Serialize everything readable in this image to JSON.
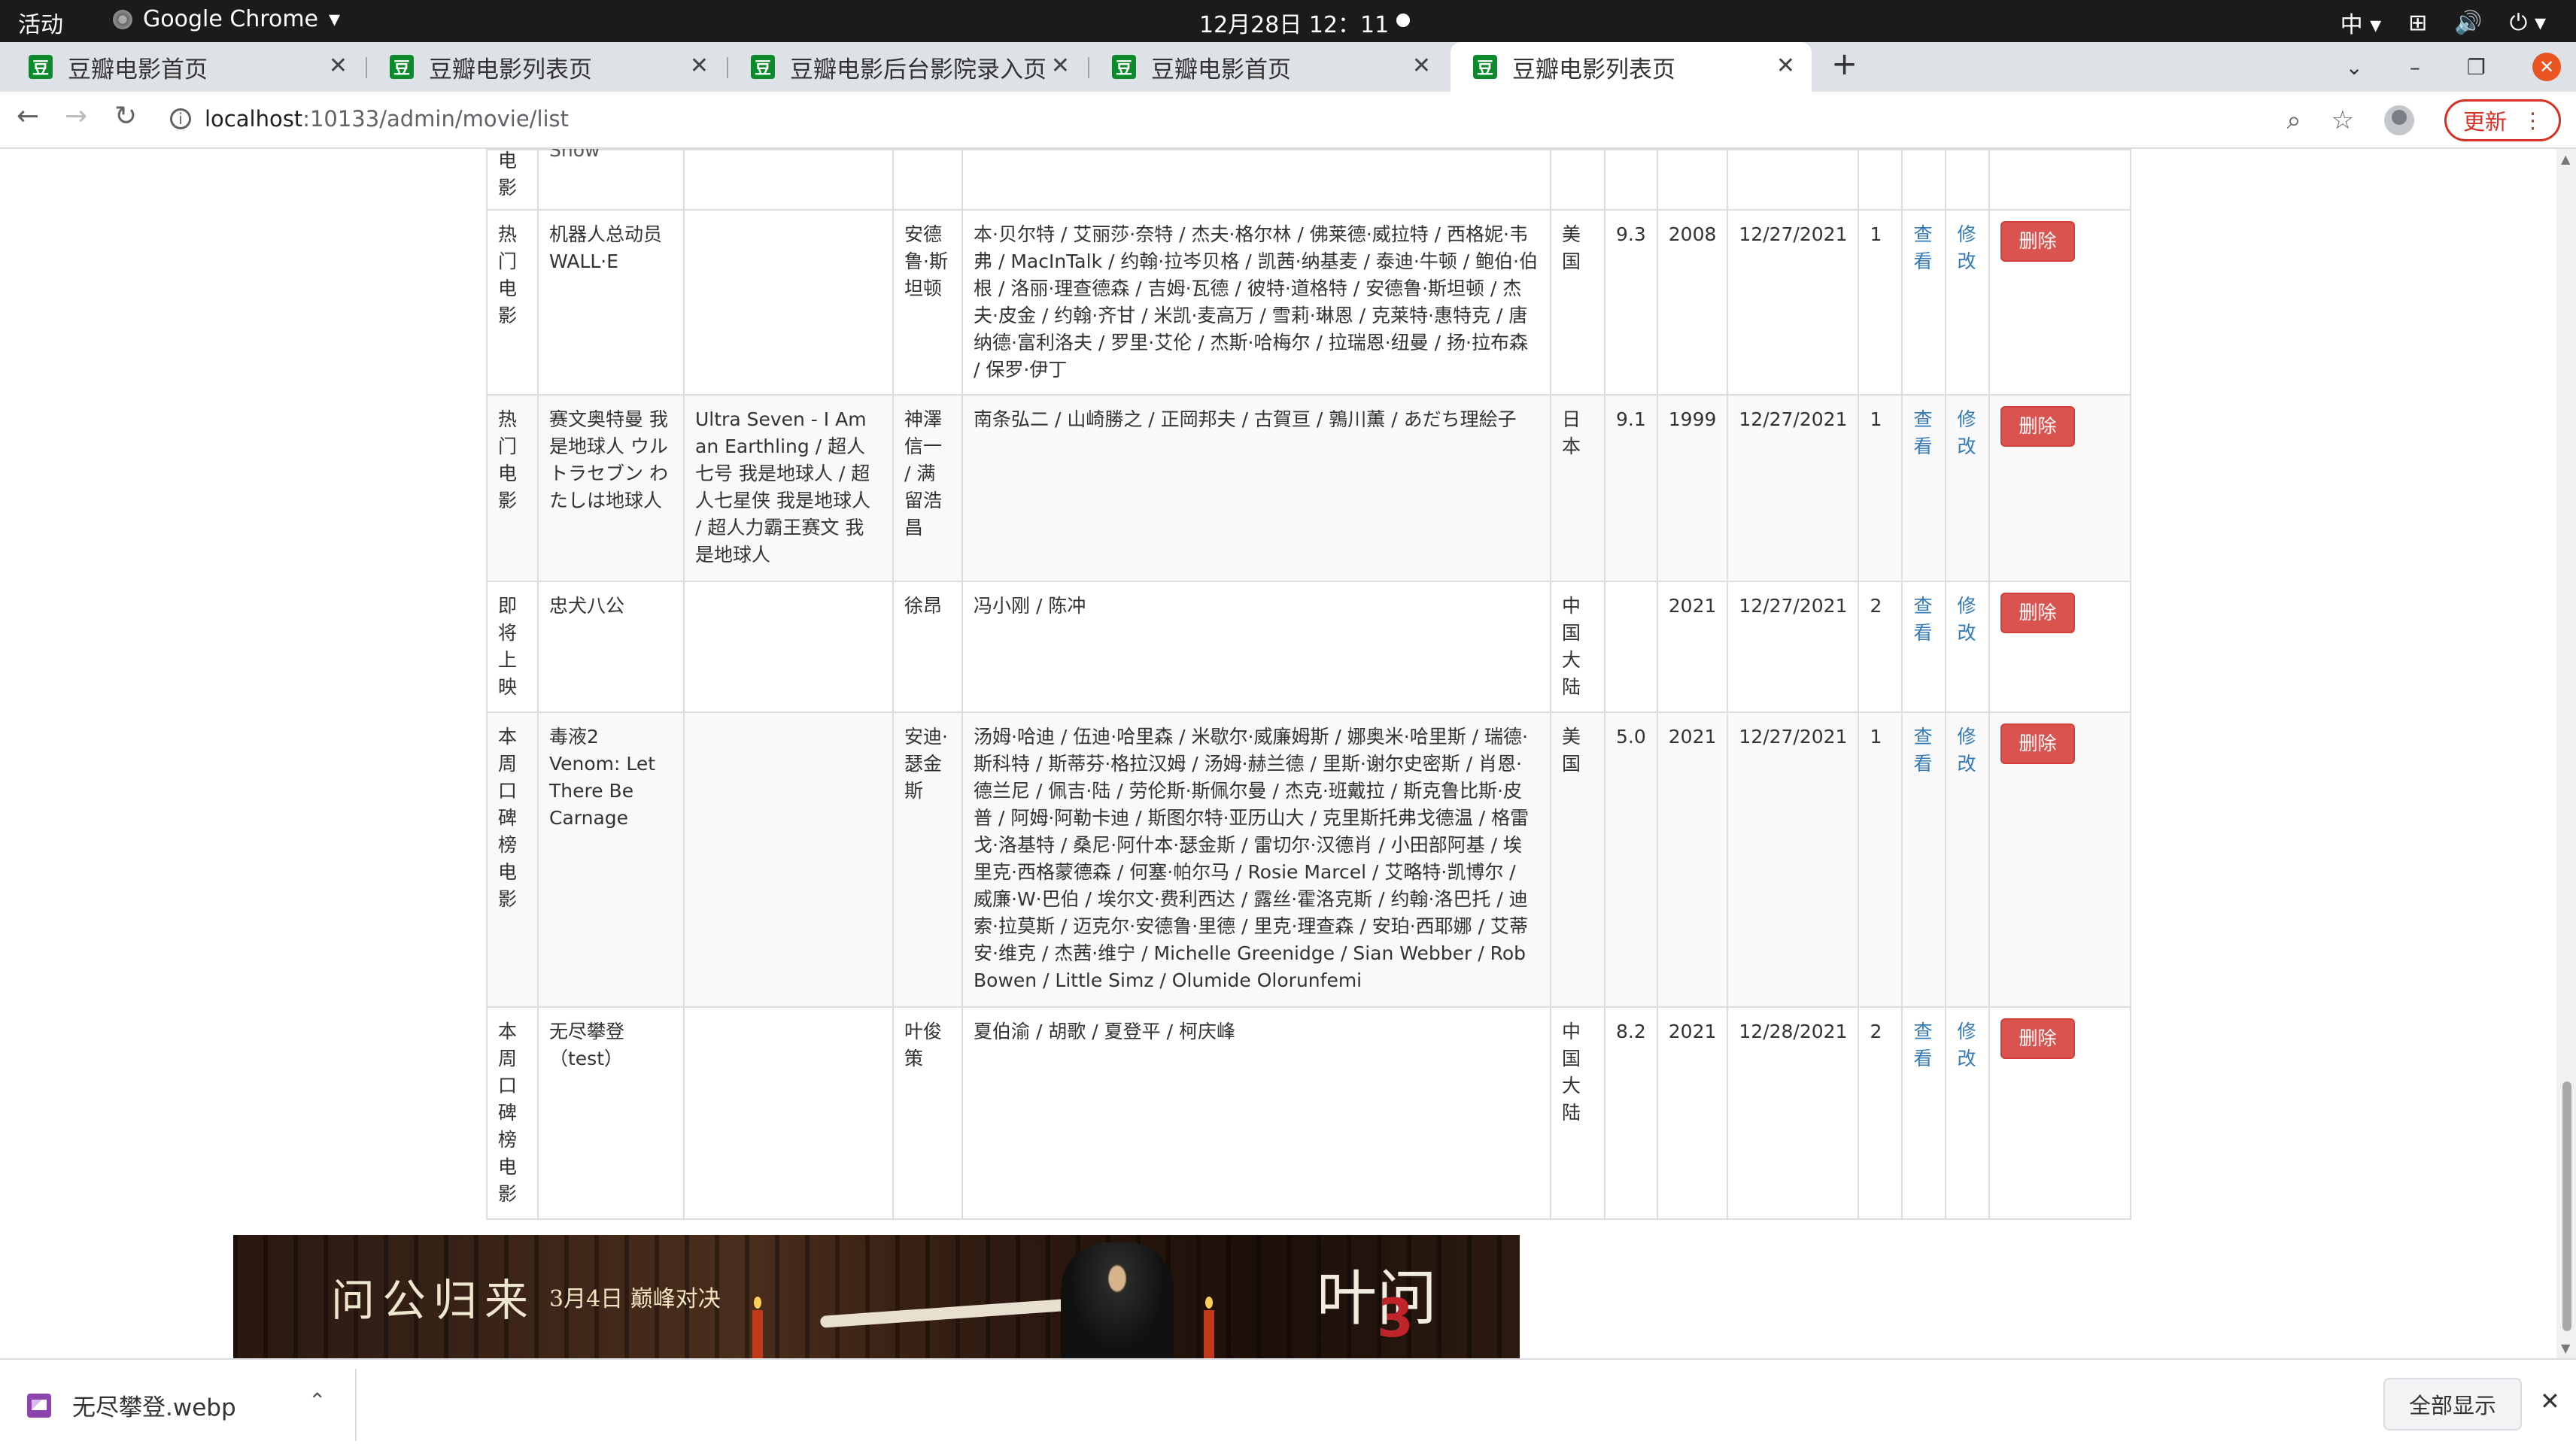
{
  "system": {
    "activities": "活动",
    "app_name": "Google Chrome",
    "clock": "12月28日  12：11",
    "input_method": "中"
  },
  "tabs": [
    {
      "title": "豆瓣电影首页",
      "favicon": "豆"
    },
    {
      "title": "豆瓣电影列表页",
      "favicon": "豆"
    },
    {
      "title": "豆瓣电影后台影院录入页",
      "favicon": "豆"
    },
    {
      "title": "豆瓣电影首页",
      "favicon": "豆"
    },
    {
      "title": "豆瓣电影列表页",
      "favicon": "豆",
      "active": true
    }
  ],
  "toolbar": {
    "url_host": "localhost",
    "url_path": ":10133/admin/movie/list",
    "update_label": "更新"
  },
  "table": {
    "partial_top_row": {
      "type": "电影",
      "name": "Show"
    },
    "rows": [
      {
        "type": "热门电影",
        "name": "机器人总动员 WALL·E",
        "alias": "",
        "director": "安德鲁·斯坦顿",
        "actors": "本·贝尔特 / 艾丽莎·奈特 / 杰夫·格尔林 / 佛莱德·威拉特 / 西格妮·韦弗 / MacInTalk / 约翰·拉岑贝格 / 凯茜·纳基麦 / 泰迪·牛顿 / 鲍伯·伯根 / 洛丽·理查德森 / 吉姆·瓦德 / 彼特·道格特 / 安德鲁·斯坦顿 / 杰夫·皮金 / 约翰·齐甘 / 米凯·麦高万 / 雪莉·琳恩 / 克莱特·惠特克 / 唐纳德·富利洛夫 / 罗里·艾伦 / 杰斯·哈梅尔 / 拉瑞恩·纽曼 / 扬·拉布森 / 保罗·伊丁",
        "region": "美国",
        "rating": "9.3",
        "year": "2008",
        "date": "12/27/2021",
        "count": "1"
      },
      {
        "type": "热门电影",
        "name": "赛文奥特曼 我是地球人 ウルトラセブン わたしは地球人",
        "alias": "Ultra Seven - I Am an Earthling / 超人七号 我是地球人 / 超人七星侠 我是地球人 / 超人力霸王赛文 我是地球人",
        "director": "神澤信一 / 满留浩昌",
        "actors": "南条弘二 / 山崎勝之 / 正岡邦夫 / 古賀亘 / 鶉川薫 / あだち理絵子",
        "region": "日本",
        "rating": "9.1",
        "year": "1999",
        "date": "12/27/2021",
        "count": "1"
      },
      {
        "type": "即将上映",
        "name": "忠犬八公",
        "alias": "",
        "director": "徐昂",
        "actors": "冯小刚 / 陈冲",
        "region": "中国大陆",
        "rating": "",
        "year": "2021",
        "date": "12/27/2021",
        "count": "2"
      },
      {
        "type": "本周口碑榜电影",
        "name": "毒液2 Venom: Let There Be Carnage",
        "alias": "",
        "director": "安迪·瑟金斯",
        "actors": "汤姆·哈迪 / 伍迪·哈里森 / 米歇尔·威廉姆斯 / 娜奥米·哈里斯 / 瑞德·斯科特 / 斯蒂芬·格拉汉姆 / 汤姆·赫兰德 / 里斯·谢尔史密斯 / 肖恩·德兰尼 / 佩吉·陆 / 劳伦斯·斯佩尔曼 / 杰克·班戴拉 / 斯克鲁比斯·皮普 / 阿姆·阿勒卡迪 / 斯图尔特·亚历山大 / 克里斯托弗戈德温 / 格雷戈·洛基特 / 桑尼·阿什本·瑟金斯 / 雷切尔·汉德肖 / 小田部阿基 / 埃里克·西格蒙德森 / 何塞·帕尔马 / Rosie Marcel / 艾略特·凯博尔 / 威廉·W·巴伯 / 埃尔文·费利西达 / 露丝·霍洛克斯 / 约翰·洛巴托 / 迪索·拉莫斯 / 迈克尔·安德鲁·里德 / 里克·理查森 / 安珀·西耶娜 / 艾蒂安·维克 / 杰茜·维宁 / Michelle Greenidge / Sian Webber / Rob Bowen / Little Simz / Olumide Olorunfemi",
        "region": "美国",
        "rating": "5.0",
        "year": "2021",
        "date": "12/27/2021",
        "count": "1"
      },
      {
        "type": "本周口碑榜电影",
        "name": "无尽攀登（test）",
        "alias": "",
        "director": "叶俊策",
        "actors": "夏伯渝 / 胡歌 / 夏登平 / 柯庆峰",
        "region": "中国大陆",
        "rating": "8.2",
        "year": "2021",
        "date": "12/28/2021",
        "count": "2"
      }
    ],
    "view_label": "查看",
    "edit_label": "修改",
    "delete_label": "删除"
  },
  "banner": {
    "title": "问公归来",
    "subtitle": "3月4日 巅峰对决",
    "logo": "叶问",
    "logo_number": "3"
  },
  "downloads": {
    "file_name": "无尽攀登.webp",
    "show_all_label": "全部显示"
  }
}
